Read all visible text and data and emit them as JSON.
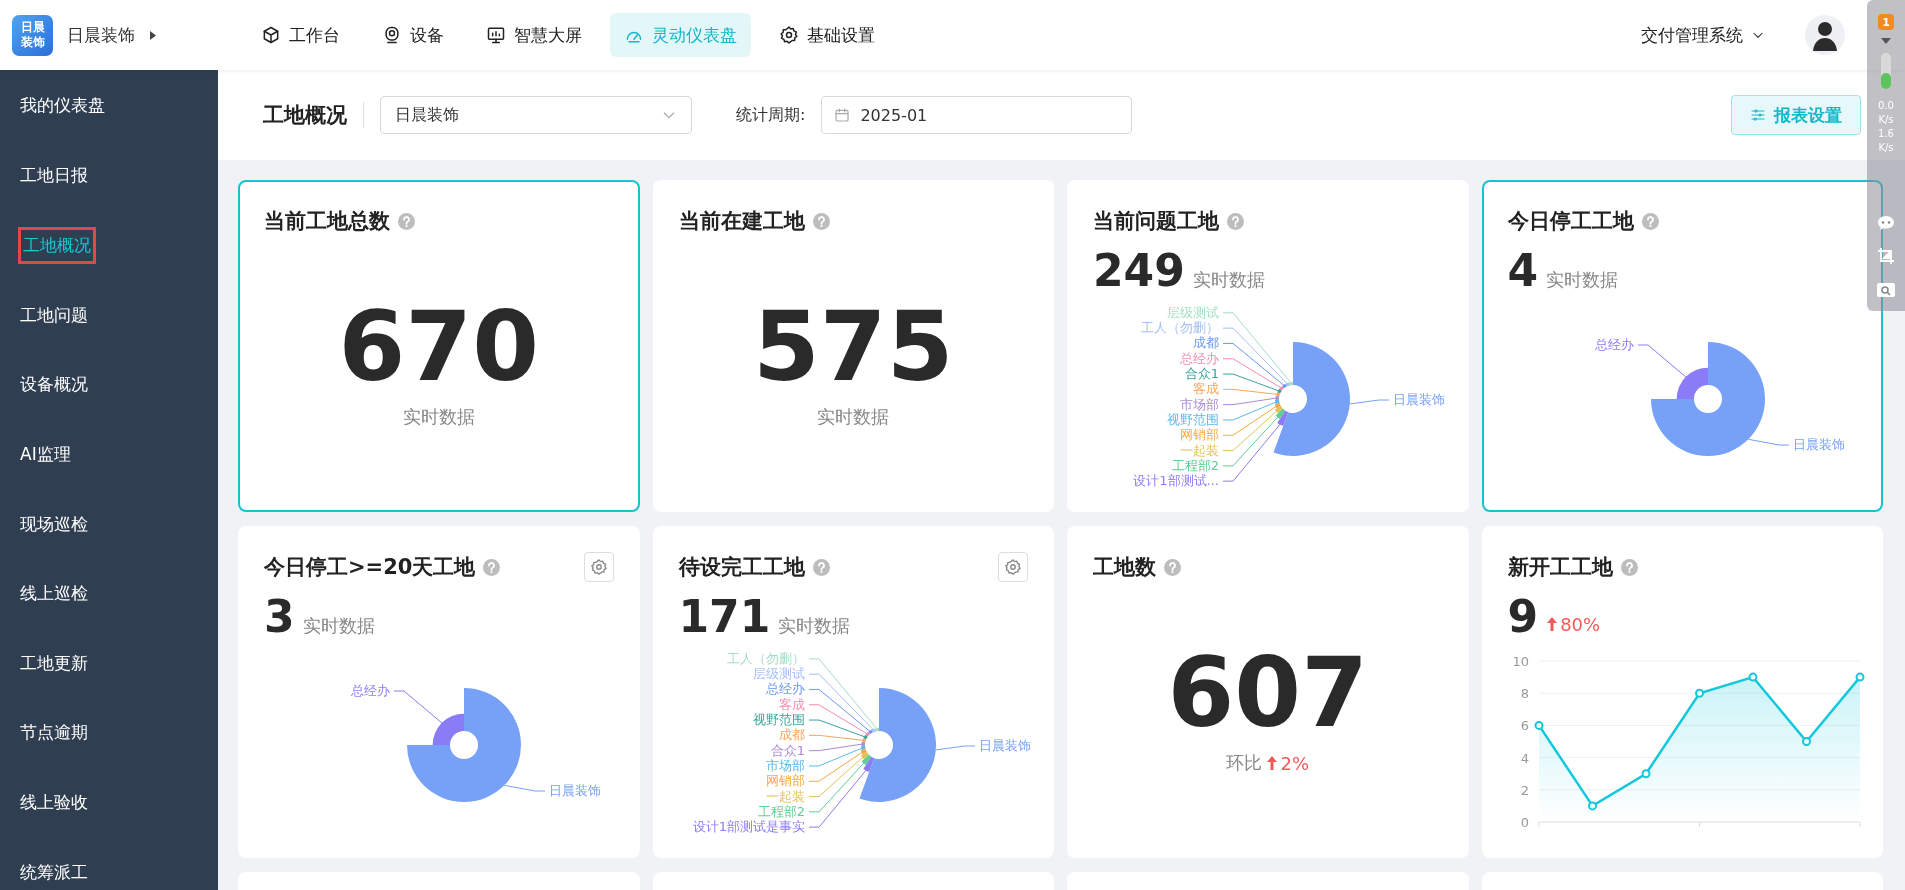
{
  "topbar": {
    "logo_lines": [
      "日晨",
      "装饰"
    ],
    "company": "日晨装饰",
    "nav": [
      {
        "label": "工作台",
        "kind": "cube",
        "selected": false
      },
      {
        "label": "设备",
        "kind": "camera",
        "selected": false
      },
      {
        "label": "智慧大屏",
        "kind": "monitor",
        "selected": false
      },
      {
        "label": "灵动仪表盘",
        "kind": "gauge",
        "selected": true
      },
      {
        "label": "基础设置",
        "kind": "gear",
        "selected": false
      }
    ],
    "system": "交付管理系统"
  },
  "sidebar": {
    "items": [
      {
        "label": "我的仪表盘",
        "selected": false
      },
      {
        "label": "工地日报",
        "selected": false
      },
      {
        "label": "工地概况",
        "selected": true
      },
      {
        "label": "工地问题",
        "selected": false
      },
      {
        "label": "设备概况",
        "selected": false
      },
      {
        "label": "AI监理",
        "selected": false
      },
      {
        "label": "现场巡检",
        "selected": false
      },
      {
        "label": "线上巡检",
        "selected": false
      },
      {
        "label": "工地更新",
        "selected": false
      },
      {
        "label": "节点逾期",
        "selected": false
      },
      {
        "label": "线上验收",
        "selected": false
      },
      {
        "label": "统筹派工",
        "selected": false
      }
    ]
  },
  "toolbar": {
    "title": "工地概况",
    "company_select": "日晨装饰",
    "period_label": "统计周期:",
    "period_value": "2025-01",
    "settings_button": "报表设置"
  },
  "cards": [
    {
      "kind": "total",
      "title": "当前工地总数",
      "value": "670",
      "caption": "实时数据",
      "highlighted": true,
      "settings": false
    },
    {
      "kind": "total",
      "title": "当前在建工地",
      "value": "575",
      "caption": "实时数据",
      "highlighted": false,
      "settings": false
    },
    {
      "kind": "pie",
      "title": "当前问题工地",
      "value": "249",
      "caption": "实时数据",
      "highlighted": false,
      "settings": false,
      "slices": [
        {
          "label": "层级测试",
          "color": "#a3dfc3"
        },
        {
          "label": "工人（勿删）",
          "color": "#a4c0f2"
        },
        {
          "label": "成都",
          "color": "#6b98f0"
        },
        {
          "label": "总经办",
          "color": "#f28cb3"
        },
        {
          "label": "合众1",
          "color": "#3aa39a"
        },
        {
          "label": "客成",
          "color": "#f9a55e"
        },
        {
          "label": "市场部",
          "color": "#a98bd8"
        },
        {
          "label": "视野范围",
          "color": "#5fb9e6"
        },
        {
          "label": "网销部",
          "color": "#f7a943"
        },
        {
          "label": "一起装",
          "color": "#e3c25a"
        },
        {
          "label": "工程部2",
          "color": "#5fcf93"
        },
        {
          "label": "设计1部测试...",
          "color": "#8a7cf7"
        },
        {
          "label": "日晨装饰",
          "color": "#76a1f7"
        }
      ]
    },
    {
      "kind": "pie",
      "title": "今日停工工地",
      "value": "4",
      "caption": "实时数据",
      "highlighted": true,
      "settings": false,
      "slices": [
        {
          "label": "总经办",
          "color": "#8a7cf7"
        },
        {
          "label": "日晨装饰",
          "color": "#76a1f7"
        }
      ]
    },
    {
      "kind": "pie",
      "title": "今日停工>=20天工地",
      "value": "3",
      "caption": "实时数据",
      "highlighted": false,
      "settings": true,
      "slices": [
        {
          "label": "总经办",
          "color": "#8a7cf7"
        },
        {
          "label": "日晨装饰",
          "color": "#76a1f7"
        }
      ]
    },
    {
      "kind": "pie",
      "title": "待设完工工地",
      "value": "171",
      "caption": "实时数据",
      "highlighted": false,
      "settings": true,
      "slices": [
        {
          "label": "工人（勿删）",
          "color": "#a3dfc3"
        },
        {
          "label": "层级测试",
          "color": "#a4c0f2"
        },
        {
          "label": "总经办",
          "color": "#6b98f0"
        },
        {
          "label": "客成",
          "color": "#f28cb3"
        },
        {
          "label": "视野范围",
          "color": "#3aa39a"
        },
        {
          "label": "成都",
          "color": "#f9a55e"
        },
        {
          "label": "合众1",
          "color": "#a98bd8"
        },
        {
          "label": "市场部",
          "color": "#5fb9e6"
        },
        {
          "label": "网销部",
          "color": "#f7a943"
        },
        {
          "label": "一起装",
          "color": "#e3c25a"
        },
        {
          "label": "工程部2",
          "color": "#5fcf93"
        },
        {
          "label": "设计1部测试是事实",
          "color": "#8a7cf7"
        },
        {
          "label": "日晨装饰",
          "color": "#76a1f7"
        }
      ]
    },
    {
      "kind": "total",
      "title": "工地数",
      "value": "607",
      "caption": "环比",
      "change": "2%",
      "highlighted": false,
      "settings": false
    },
    {
      "kind": "line",
      "title": "新开工工地",
      "value": "9",
      "change": "80%",
      "highlighted": false,
      "settings": false,
      "chart_data": {
        "type": "area",
        "grid": true,
        "series": [
          {
            "color": "#12c8dc",
            "marker": "circle",
            "values": [
              6,
              1,
              3,
              8,
              9,
              5,
              9
            ]
          }
        ],
        "ylim": [
          0,
          10
        ],
        "yticks": [
          0,
          2,
          4,
          6,
          8,
          10
        ]
      }
    },
    {
      "kind": "empty",
      "highlighted": false
    },
    {
      "kind": "empty",
      "highlighted": false
    },
    {
      "kind": "empty",
      "highlighted": false
    },
    {
      "kind": "empty",
      "highlighted": false
    }
  ],
  "overlay": {
    "badge": "1",
    "rates": [
      "0.0",
      "K/s",
      "1.6",
      "K/s"
    ]
  }
}
